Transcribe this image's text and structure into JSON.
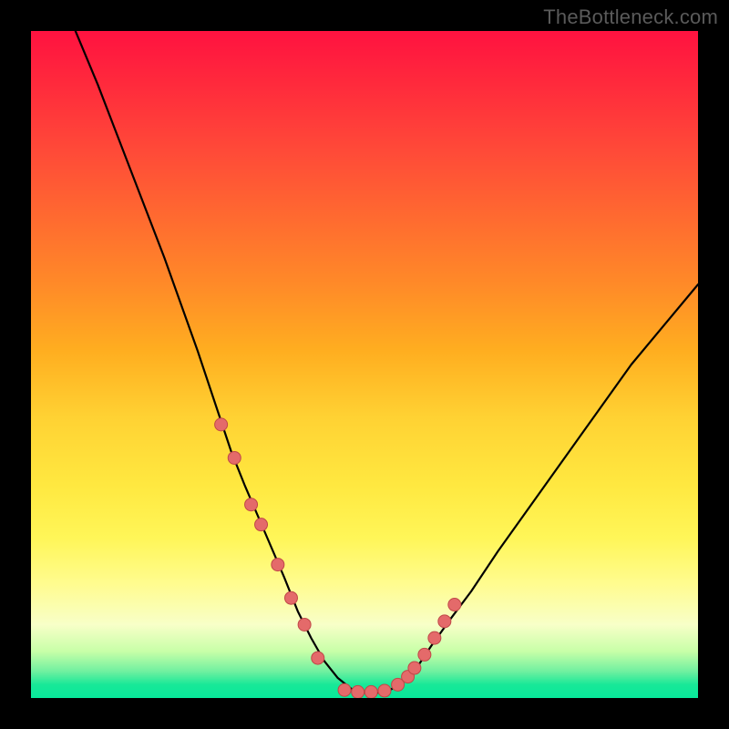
{
  "watermark": "TheBottleneck.com",
  "colors": {
    "curve_stroke": "#000000",
    "dot_fill": "#e46a6a",
    "dot_stroke": "#c04848"
  },
  "chart_data": {
    "type": "line",
    "title": "",
    "xlabel": "",
    "ylabel": "",
    "xlim": [
      0,
      100
    ],
    "ylim": [
      0,
      100
    ],
    "series": [
      {
        "name": "bottleneck-curve",
        "description": "V-shaped bottleneck curve; y is approximate bottleneck % read from vertical position (0 at bottom, 100 at top).",
        "x": [
          5,
          10,
          15,
          20,
          25,
          28,
          30,
          32,
          35,
          38,
          40,
          42,
          44,
          46,
          48,
          50,
          52,
          54,
          56,
          58,
          60,
          63,
          66,
          70,
          75,
          80,
          85,
          90,
          95,
          100
        ],
        "y": [
          104,
          92,
          79,
          66,
          52,
          43,
          37,
          32,
          25,
          18,
          13,
          9,
          5.5,
          3,
          1.4,
          0.8,
          0.8,
          1.3,
          2.6,
          4.8,
          7.8,
          12,
          16,
          22,
          29,
          36,
          43,
          50,
          56,
          62
        ]
      }
    ],
    "points": {
      "name": "highlighted-data-points",
      "description": "Salmon dots marking sampled positions along the lower part of the curve.",
      "x": [
        28.5,
        30.5,
        33,
        34.5,
        37,
        39,
        41,
        43,
        47,
        49,
        51,
        53,
        55,
        56.5,
        57.5,
        59,
        60.5,
        62,
        63.5
      ],
      "y": [
        41,
        36,
        29,
        26,
        20,
        15,
        11,
        6,
        1.2,
        0.9,
        0.9,
        1.1,
        2,
        3.2,
        4.5,
        6.5,
        9,
        11.5,
        14
      ]
    }
  }
}
